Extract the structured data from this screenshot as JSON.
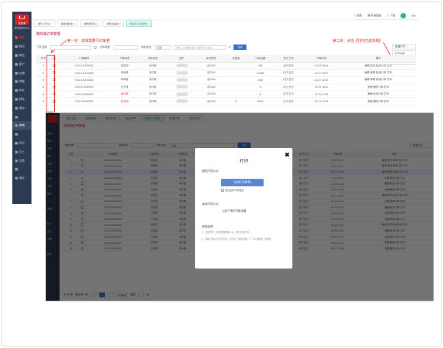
{
  "app": {
    "logo_text": "生意通",
    "shop_name": "有赞微商Shop",
    "nav": [
      {
        "label": "首页",
        "state": "active"
      },
      {
        "label": "概况",
        "state": ""
      },
      {
        "label": "商品",
        "state": ""
      },
      {
        "label": "客户",
        "state": ""
      },
      {
        "label": "店铺",
        "state": ""
      },
      {
        "label": "销售",
        "state": ""
      },
      {
        "label": "库存",
        "state": ""
      },
      {
        "label": "财务",
        "state": ""
      },
      {
        "label": "服务",
        "state": ""
      },
      {
        "label": "",
        "state": ""
      },
      {
        "label": "商城",
        "state": "sel"
      },
      {
        "label": "",
        "state": ""
      },
      {
        "label": "积分",
        "state": ""
      },
      {
        "label": "员工",
        "state": ""
      },
      {
        "label": "设置",
        "state": ""
      },
      {
        "label": "",
        "state": ""
      },
      {
        "label": "服务",
        "state": ""
      }
    ],
    "top_right": {
      "search": "搜索",
      "help": "在线客服",
      "download": "下载",
      "user": "syk"
    }
  },
  "tabs": [
    "我的工作台",
    "新增销售单",
    "销售单列表",
    "销售出库单",
    "微商城订单管理"
  ],
  "active_tab_index": 4,
  "page_title": "微商城订单管理",
  "annotations": {
    "step1": "第一步：选择需要打印单据",
    "step2": "第二步：点击【打印已选择单】"
  },
  "filters": {
    "date_label": "下单日期:",
    "status_label": "订单状态:",
    "pay_label": "付款状态:",
    "pay_value": "全部",
    "search_placeholder": "请输入订单编号/客户名称/收货人电话",
    "search_button": "查询",
    "batch_button": "批量打印"
  },
  "batch_menu": [
    "打印全部",
    "打印已选择单"
  ],
  "table": {
    "headers": [
      "行号",
      "",
      "订单编号",
      "订单状态",
      "付款状态",
      "客户",
      "发货库存",
      "总数量",
      "订单金额",
      "支付方式",
      "下单时间",
      "操作"
    ],
    "rows": [
      {
        "n": "1",
        "no": "OLDJ110200001",
        "status": "待发货",
        "pay": "未付款",
        "wh": "店1345",
        "qty": "",
        "amt": "280",
        "method": "线下支付",
        "time": "10-28 09:44",
        "ops": "编辑 发货 取消订单 打印"
      },
      {
        "n": "2",
        "no": "OLDJ110270002",
        "status": "待审核",
        "pay": "未付款",
        "wh": "店1345",
        "qty": "",
        "amt": "5.5585",
        "method": "线下支付",
        "time": "10-27 16:27",
        "ops": "编辑 审核 取消订单 打印"
      },
      {
        "n": "3",
        "no": "OLDJ110270001",
        "status": "待审核",
        "pay": "未付款",
        "wh": "店1345",
        "qty": "",
        "amt": "5.55",
        "method": "线下支付",
        "time": "10-27 10:24",
        "ops": "编辑 审核 取消订单 打印"
      },
      {
        "n": "4",
        "no": "OLDJ112260002",
        "status": "已完成",
        "pay": "未付款",
        "wh": "店1345",
        "qty": "",
        "amt": "5",
        "method": "线上支付",
        "time": "12-26 18:01",
        "ops": "查看 删除订单 打印"
      },
      {
        "n": "5",
        "no": "OLDJ112260001",
        "status": "待付款",
        "pay": "未付款",
        "wh": "店1345",
        "qty": "",
        "amt": "5",
        "method": "线下支付",
        "time": "12-26 14:38",
        "ops": "编辑 取消订单 打印"
      },
      {
        "n": "6",
        "no": "OLDJ111160001",
        "status": "已关闭",
        "pay": "未付款",
        "wh": "店1345",
        "qty": "70",
        "amt": "6400",
        "method": "线下支付",
        "time": "11-16 13:49",
        "ops": "查看 删除订单 打印"
      }
    ]
  },
  "screenshot2": {
    "tabs": [
      "我的工作台",
      "新增销售单",
      "销售单列表",
      "销售出库单",
      "微商城订单管理",
      "送货单列表",
      "送货单打印"
    ],
    "title": "微商城订单管理",
    "filter_date": "下单日期:",
    "filter_status": "订单状态:",
    "filter_pay": "付款状态:",
    "filter_pay_value": "全部",
    "search_button": "查询",
    "batch_button": "批量打印",
    "headers": [
      "行号",
      "",
      "订单编号",
      "订单状态",
      "付款状态",
      "客户",
      "发货库存",
      "总数量",
      "订单金额",
      "支付方式",
      "下单时间",
      "操作"
    ],
    "rows": [
      {
        "n": "1",
        "no": "OLDJ110200001",
        "status": "待发货",
        "pay": "未付款",
        "method": "线下支付",
        "time": "10-28 09:44",
        "ops": "编辑 发货 取消订单 打印",
        "hl": false
      },
      {
        "n": "2",
        "no": "OLDJ110270002",
        "status": "待审核",
        "pay": "未付款",
        "method": "线下支付",
        "time": "10-27 16:27",
        "ops": "编辑 审核 取消订单 打印",
        "hl": false
      },
      {
        "n": "3",
        "no": "OLDJ110270001",
        "status": "待审核",
        "pay": "未付款",
        "method": "线下支付",
        "time": "10-27 10:24",
        "ops": "编辑 审核 取消订单 打印",
        "hl": true
      },
      {
        "n": "4",
        "no": "OLDJ112260002",
        "status": "已完成",
        "pay": "未付款",
        "method": "线上支付",
        "time": "12-26 18:01",
        "ops": "查看 删除订单 打印",
        "hl": false
      },
      {
        "n": "5",
        "no": "OLDJ112260001",
        "status": "待付款",
        "pay": "未付款",
        "method": "线下支付",
        "time": "12-26 14:38",
        "ops": "编辑 取消订单 打印",
        "hl": false
      },
      {
        "n": "6",
        "no": "OLDJ111160001",
        "status": "已关闭",
        "pay": "未付款",
        "method": "线下支付",
        "time": "11-16 13:49",
        "ops": "查看 删除订单 打印",
        "hl": false
      },
      {
        "n": "7",
        "no": "OLDJ111100001",
        "status": "待发货",
        "pay": "未付款",
        "method": "线下支付",
        "time": "11-10 14:02",
        "ops": "编辑 发货 取消订单 打印",
        "hl": false
      },
      {
        "n": "8",
        "no": "OLDJ110090001",
        "status": "已关闭",
        "pay": "未付款",
        "method": "线下支付",
        "time": "10-09 16:45",
        "ops": "查看 删除订单 打印",
        "hl": false
      },
      {
        "n": "9",
        "no": "OLDJ109290002",
        "status": "待付款",
        "pay": "未付款",
        "method": "线下支付",
        "time": "09-29 16:22",
        "ops": "编辑 取消订单 打印",
        "hl": false
      },
      {
        "n": "10",
        "no": "OLDJ109290001",
        "status": "已完成",
        "pay": "未付款",
        "method": "线下支付",
        "time": "09-29 10:31",
        "ops": "查看 删除订单 打印",
        "hl": false
      },
      {
        "n": "11",
        "no": "OLDJ109260003",
        "status": "已关闭",
        "pay": "未付款",
        "method": "线下支付",
        "time": "09-26 15:03",
        "ops": "查看 删除订单 打印",
        "hl": false
      },
      {
        "n": "12",
        "no": "OLDJ109260002",
        "status": "待发货",
        "pay": "未付款",
        "method": "线下支付",
        "time": "09-26 14:50",
        "ops": "编辑 发货 取消订单 打印",
        "hl": false
      },
      {
        "n": "13",
        "no": "OLDJ109260001",
        "status": "待付款",
        "pay": "未付款",
        "method": "线下支付",
        "time": "09-26 10:08",
        "ops": "编辑 取消订单 打印",
        "hl": false
      },
      {
        "n": "14",
        "no": "OLDJ109150001",
        "status": "已完成",
        "pay": "未付款",
        "method": "线下支付",
        "time": "09-15 17:22",
        "ops": "查看 删除订单 打印",
        "hl": false
      },
      {
        "n": "15",
        "no": "OLDJ109020001",
        "status": "已关闭",
        "pay": "未付款",
        "method": "线下支付",
        "time": "09-02 11:46",
        "ops": "查看 删除订单 打印",
        "hl": false
      },
      {
        "n": "16",
        "no": "OLDJ108120001",
        "status": "已完成",
        "pay": "未付款",
        "method": "线下支付",
        "time": "08-12 15:55",
        "ops": "查看 删除订单 打印",
        "hl": false
      }
    ],
    "pager": {
      "total": "共 20 条",
      "pages": "跳至第 2 页",
      "current": "1",
      "size": "50 条/页",
      "goto": "跳至",
      "page_unit": "页"
    }
  },
  "modal": {
    "title": "打印",
    "section1": "图形打印方式",
    "primary_button": "在线打印(推荐)",
    "checkbox_label": "退出后打印时退出",
    "section2": "其他打印方式",
    "secondary_link": "点击下载打印驱动器",
    "section3": "帮助说明",
    "note1": "1、在线打印【打印配置模板】后，再行在线打印。",
    "note2": "2、选择了默认打印方式后，可以在「系统设置」＞「打印配置」中修改。"
  },
  "colors": {
    "accent": "#2f6fd6",
    "annotation": "#e0261b",
    "sidebar": "#2c3b4f",
    "brand": "#d9232b"
  }
}
